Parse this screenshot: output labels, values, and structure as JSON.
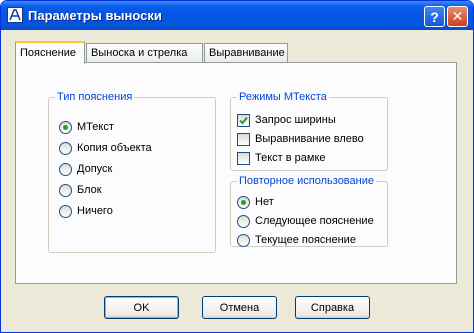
{
  "window": {
    "title": "Параметры выноски",
    "help_button": "?",
    "close_button": "✕"
  },
  "tabs": [
    {
      "label": "Пояснение",
      "active": true
    },
    {
      "label": "Выноска и стрелка",
      "active": false
    },
    {
      "label": "Выравнивание",
      "active": false
    }
  ],
  "annotation_type": {
    "legend": "Тип пояснения",
    "options": [
      {
        "label": "МТекст",
        "selected": true
      },
      {
        "label": "Копия объекта",
        "selected": false
      },
      {
        "label": "Допуск",
        "selected": false
      },
      {
        "label": "Блок",
        "selected": false
      },
      {
        "label": "Ничего",
        "selected": false
      }
    ]
  },
  "mtext_options": {
    "legend": "Режимы МТекста",
    "options": [
      {
        "label": "Запрос ширины",
        "checked": true
      },
      {
        "label": "Выравнивание влево",
        "checked": false
      },
      {
        "label": "Текст в рамке",
        "checked": false
      }
    ]
  },
  "reuse": {
    "legend": "Повторное использование",
    "options": [
      {
        "label": "Нет",
        "selected": true
      },
      {
        "label": "Следующее пояснение",
        "selected": false
      },
      {
        "label": "Текущее пояснение",
        "selected": false
      }
    ]
  },
  "buttons": {
    "ok": "OK",
    "cancel": "Отмена",
    "help": "Справка"
  },
  "colors": {
    "titlebar": "#0554E3",
    "dialog_bg": "#ECE9D8",
    "group_legend": "#0046D5",
    "active_tab_highlight": "#FFC73C",
    "radio_dot": "#21A121"
  }
}
